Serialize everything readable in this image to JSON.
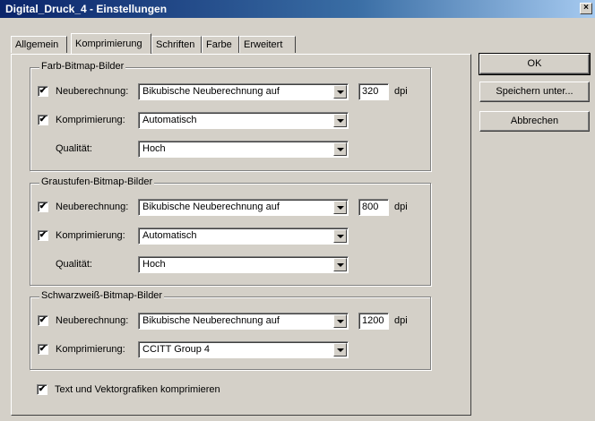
{
  "window": {
    "title": "Digital_Druck_4 - Einstellungen",
    "close": "×"
  },
  "tabs": [
    "Allgemein",
    "Komprimierung",
    "Schriften",
    "Farbe",
    "Erweitert"
  ],
  "buttons": {
    "ok": "OK",
    "save_as": "Speichern unter...",
    "cancel": "Abbrechen"
  },
  "groups": {
    "color": {
      "title": "Farb-Bitmap-Bilder",
      "resample_label": "Neuberechnung:",
      "resample_value": "Bikubische Neuberechnung auf",
      "resolution": "320",
      "unit": "dpi",
      "compress_label": "Komprimierung:",
      "compress_value": "Automatisch",
      "quality_label": "Qualität:",
      "quality_value": "Hoch"
    },
    "gray": {
      "title": "Graustufen-Bitmap-Bilder",
      "resample_label": "Neuberechnung:",
      "resample_value": "Bikubische Neuberechnung auf",
      "resolution": "800",
      "unit": "dpi",
      "compress_label": "Komprimierung:",
      "compress_value": "Automatisch",
      "quality_label": "Qualität:",
      "quality_value": "Hoch"
    },
    "mono": {
      "title": "Schwarzweiß-Bitmap-Bilder",
      "resample_label": "Neuberechnung:",
      "resample_value": "Bikubische Neuberechnung auf",
      "resolution": "1200",
      "unit": "dpi",
      "compress_label": "Komprimierung:",
      "compress_value": "CCITT Group 4"
    }
  },
  "text_compress_label": "Text und Vektorgrafiken komprimieren",
  "checkmark": "✔"
}
